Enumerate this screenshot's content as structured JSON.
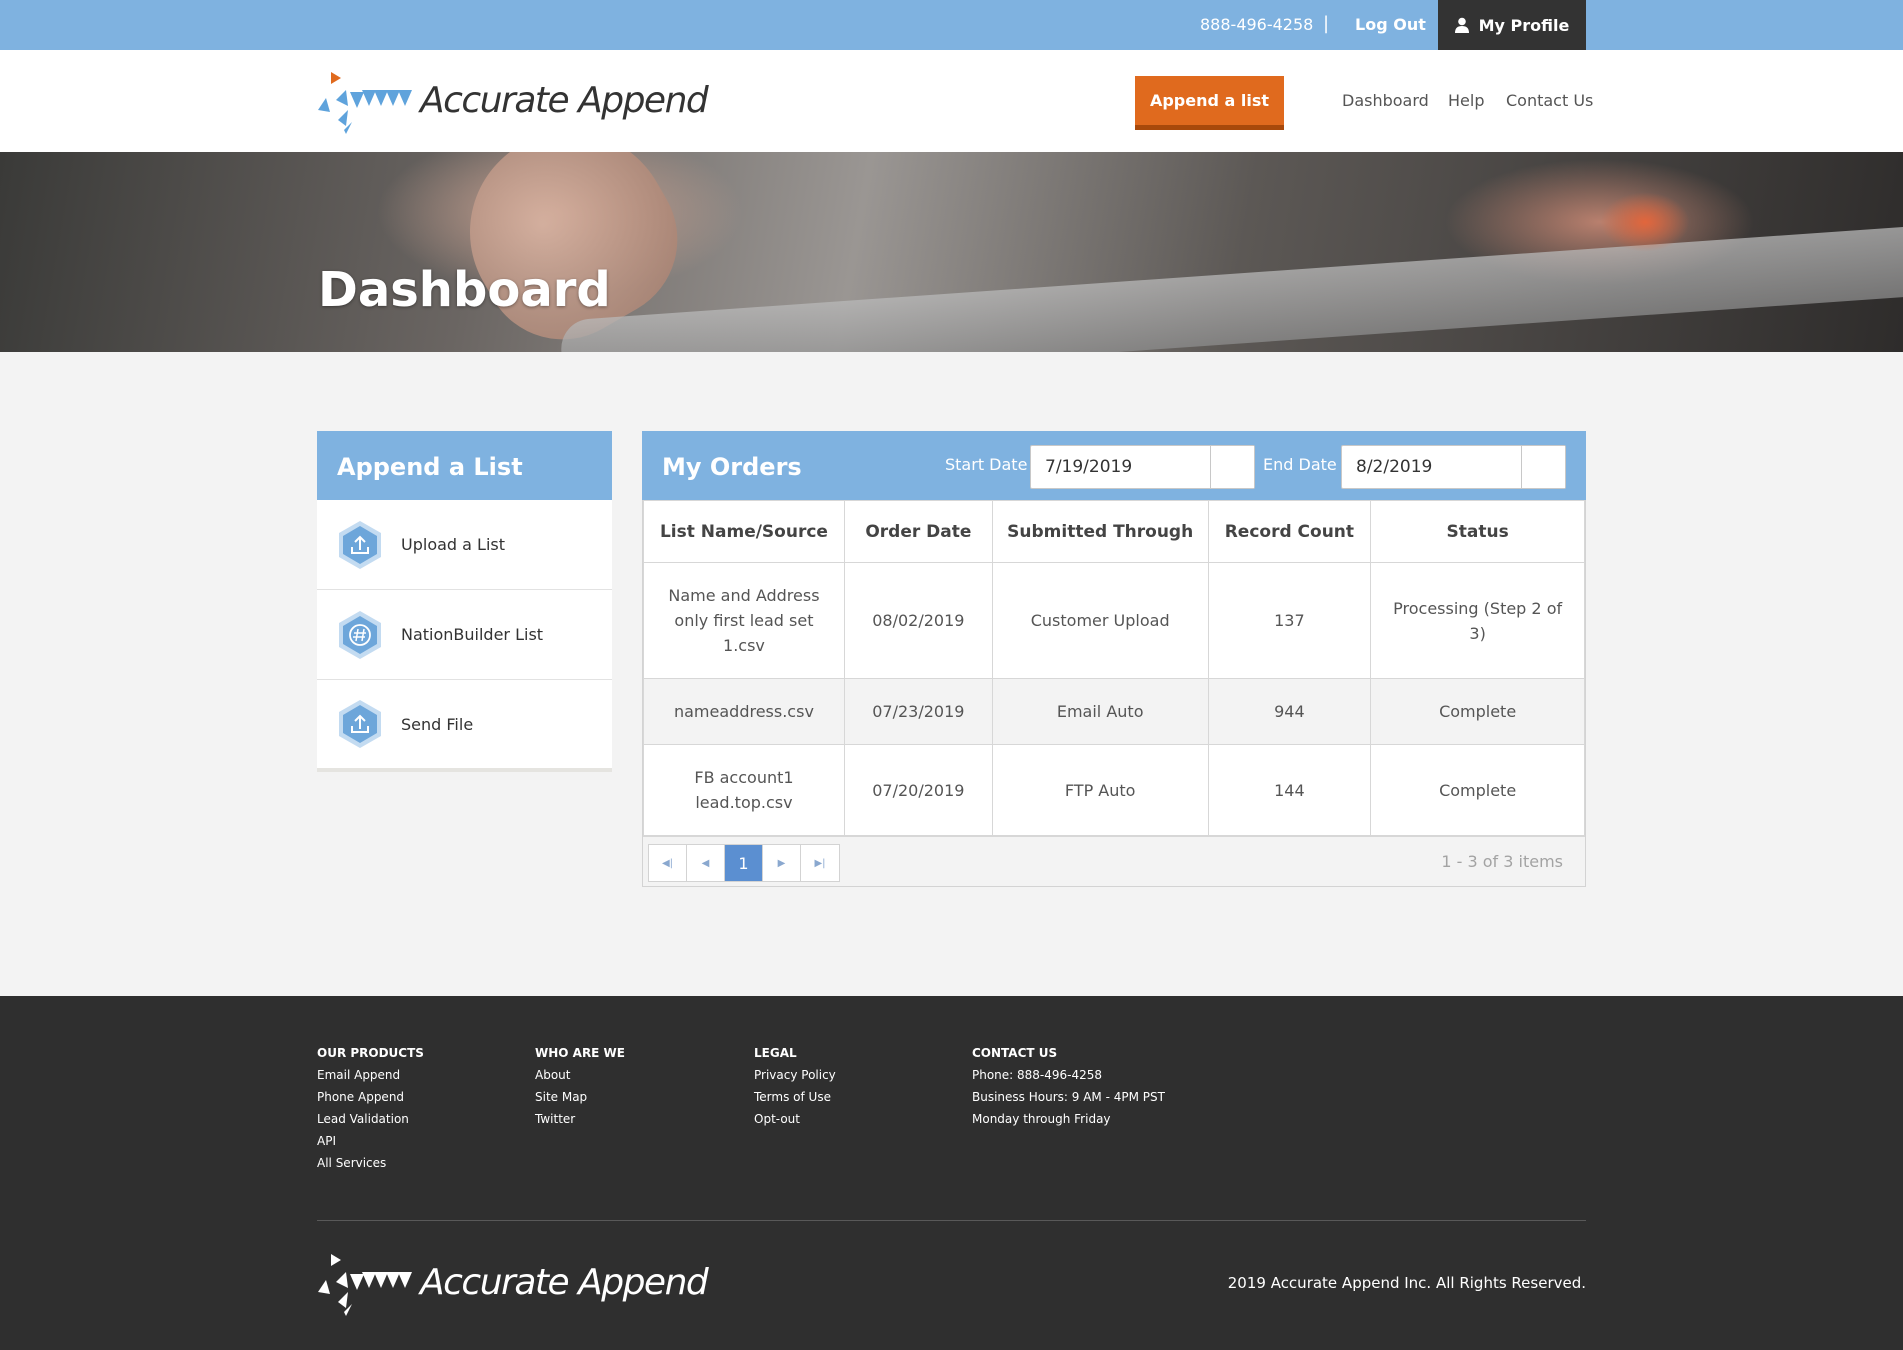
{
  "topbar": {
    "phone": "888-496-4258",
    "separator": "|",
    "logout": "Log Out",
    "profile": "My Profile"
  },
  "brand": {
    "name": "Accurate Append"
  },
  "header": {
    "cta": "Append a list",
    "nav": [
      "Dashboard",
      "Help",
      "Contact Us"
    ]
  },
  "hero": {
    "title": "Dashboard"
  },
  "sidebar": {
    "title": "Append a List",
    "items": [
      {
        "label": "Upload a List",
        "icon": "upload-icon"
      },
      {
        "label": "NationBuilder List",
        "icon": "hash-icon"
      },
      {
        "label": "Send File",
        "icon": "upload-icon"
      }
    ]
  },
  "orders": {
    "title": "My Orders",
    "start_label": "Start Date",
    "start_value": "7/19/2019",
    "end_label": "End Date",
    "end_value": "8/2/2019",
    "columns": [
      "List Name/Source",
      "Order Date",
      "Submitted Through",
      "Record Count",
      "Status"
    ],
    "rows": [
      [
        "Name and Address only first lead set 1.csv",
        "08/02/2019",
        "Customer Upload",
        "137",
        "Processing (Step 2 of 3)"
      ],
      [
        "nameaddress.csv",
        "07/23/2019",
        "Email Auto",
        "944",
        "Complete"
      ],
      [
        "FB account1 lead.top.csv",
        "07/20/2019",
        "FTP Auto",
        "144",
        "Complete"
      ]
    ],
    "pager": {
      "current": "1",
      "info": "1 - 3 of 3 items"
    }
  },
  "footer": {
    "products": {
      "title": "OUR PRODUCTS",
      "links": [
        "Email Append",
        "Phone Append",
        "Lead Validation",
        "API",
        "All Services"
      ]
    },
    "who": {
      "title": "WHO ARE WE",
      "links": [
        "About",
        "Site Map",
        "Twitter"
      ]
    },
    "legal": {
      "title": "LEGAL",
      "links": [
        "Privacy Policy",
        "Terms of Use",
        "Opt-out"
      ]
    },
    "contact": {
      "title": "CONTACT US",
      "lines": [
        "Phone: 888-496-4258",
        "Business Hours: 9 AM - 4PM PST",
        "Monday through Friday"
      ]
    },
    "copyright": "2019 Accurate Append Inc. All Rights Reserved."
  },
  "colors": {
    "accent_blue": "#7fb2e0",
    "cta_orange": "#e06a1e",
    "footer_bg": "#2f2f2f",
    "pager_active": "#5b8fd1"
  }
}
